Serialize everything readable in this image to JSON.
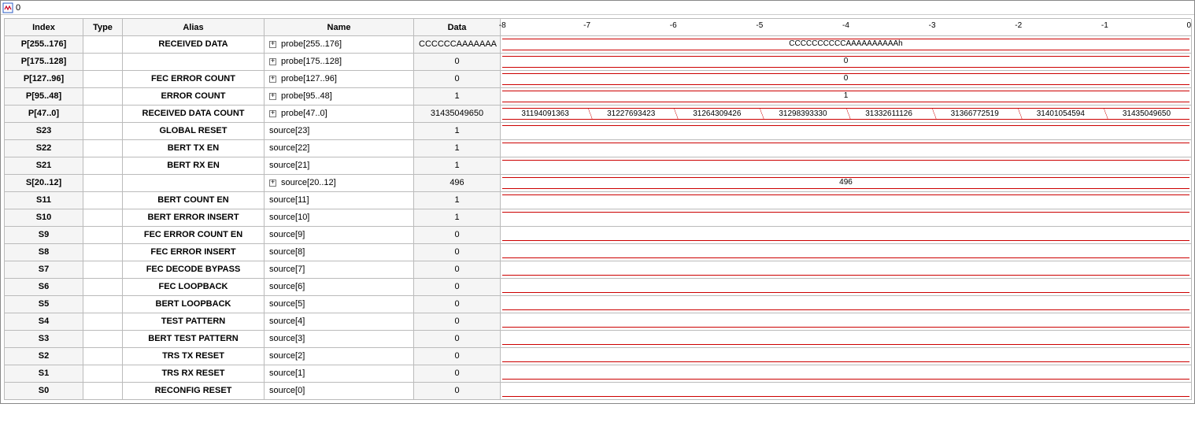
{
  "window": {
    "title": "0"
  },
  "headers": {
    "index": "Index",
    "type": "Type",
    "alias": "Alias",
    "name": "Name",
    "data": "Data"
  },
  "timescale": [
    "-8",
    "-7",
    "-6",
    "-5",
    "-4",
    "-3",
    "-2",
    "-1",
    "0"
  ],
  "rows": [
    {
      "index": "P[255..176]",
      "alias": "RECEIVED DATA",
      "name": "probe[255..176]",
      "expand": true,
      "data": "CCCCCCAAAAAAA",
      "wave": {
        "type": "bus",
        "label": "CCCCCCCCCCAAAAAAAAAAh"
      }
    },
    {
      "index": "P[175..128]",
      "alias": "",
      "name": "probe[175..128]",
      "expand": true,
      "data": "0",
      "wave": {
        "type": "bus",
        "label": "0"
      }
    },
    {
      "index": "P[127..96]",
      "alias": "FEC ERROR COUNT",
      "name": "probe[127..96]",
      "expand": true,
      "data": "0",
      "wave": {
        "type": "bus",
        "label": "0"
      }
    },
    {
      "index": "P[95..48]",
      "alias": "ERROR COUNT",
      "name": "probe[95..48]",
      "expand": true,
      "data": "1",
      "wave": {
        "type": "bus",
        "label": "1"
      }
    },
    {
      "index": "P[47..0]",
      "alias": "RECEIVED DATA COUNT",
      "name": "probe[47..0]",
      "expand": true,
      "data": "31435049650",
      "wave": {
        "type": "segments",
        "values": [
          "31194091363",
          "31227693423",
          "31264309426",
          "31298393330",
          "31332611126",
          "31366772519",
          "31401054594",
          "31435049650"
        ]
      }
    },
    {
      "index": "S23",
      "alias": "GLOBAL RESET",
      "name": "source[23]",
      "expand": false,
      "data": "1",
      "wave": {
        "type": "bit",
        "level": "high"
      }
    },
    {
      "index": "S22",
      "alias": "BERT TX EN",
      "name": "source[22]",
      "expand": false,
      "data": "1",
      "wave": {
        "type": "bit",
        "level": "high"
      }
    },
    {
      "index": "S21",
      "alias": "BERT RX EN",
      "name": "source[21]",
      "expand": false,
      "data": "1",
      "wave": {
        "type": "bit",
        "level": "high"
      }
    },
    {
      "index": "S[20..12]",
      "alias": "",
      "name": "source[20..12]",
      "expand": true,
      "data": "496",
      "wave": {
        "type": "bus",
        "label": "496"
      }
    },
    {
      "index": "S11",
      "alias": "BERT COUNT EN",
      "name": "source[11]",
      "expand": false,
      "data": "1",
      "wave": {
        "type": "bit",
        "level": "high"
      }
    },
    {
      "index": "S10",
      "alias": "BERT ERROR INSERT",
      "name": "source[10]",
      "expand": false,
      "data": "1",
      "wave": {
        "type": "bit",
        "level": "high"
      }
    },
    {
      "index": "S9",
      "alias": "FEC ERROR COUNT EN",
      "name": "source[9]",
      "expand": false,
      "data": "0",
      "wave": {
        "type": "bit",
        "level": "low"
      }
    },
    {
      "index": "S8",
      "alias": "FEC ERROR INSERT",
      "name": "source[8]",
      "expand": false,
      "data": "0",
      "wave": {
        "type": "bit",
        "level": "low"
      }
    },
    {
      "index": "S7",
      "alias": "FEC DECODE BYPASS",
      "name": "source[7]",
      "expand": false,
      "data": "0",
      "wave": {
        "type": "bit",
        "level": "low"
      }
    },
    {
      "index": "S6",
      "alias": "FEC LOOPBACK",
      "name": "source[6]",
      "expand": false,
      "data": "0",
      "wave": {
        "type": "bit",
        "level": "low"
      }
    },
    {
      "index": "S5",
      "alias": "BERT LOOPBACK",
      "name": "source[5]",
      "expand": false,
      "data": "0",
      "wave": {
        "type": "bit",
        "level": "low"
      }
    },
    {
      "index": "S4",
      "alias": "TEST PATTERN",
      "name": "source[4]",
      "expand": false,
      "data": "0",
      "wave": {
        "type": "bit",
        "level": "low"
      }
    },
    {
      "index": "S3",
      "alias": "BERT TEST PATTERN",
      "name": "source[3]",
      "expand": false,
      "data": "0",
      "wave": {
        "type": "bit",
        "level": "low"
      }
    },
    {
      "index": "S2",
      "alias": "TRS TX RESET",
      "name": "source[2]",
      "expand": false,
      "data": "0",
      "wave": {
        "type": "bit",
        "level": "low"
      }
    },
    {
      "index": "S1",
      "alias": "TRS RX RESET",
      "name": "source[1]",
      "expand": false,
      "data": "0",
      "wave": {
        "type": "bit",
        "level": "low"
      }
    },
    {
      "index": "S0",
      "alias": "RECONFIG RESET",
      "name": "source[0]",
      "expand": false,
      "data": "0",
      "wave": {
        "type": "bit",
        "level": "low"
      }
    }
  ]
}
